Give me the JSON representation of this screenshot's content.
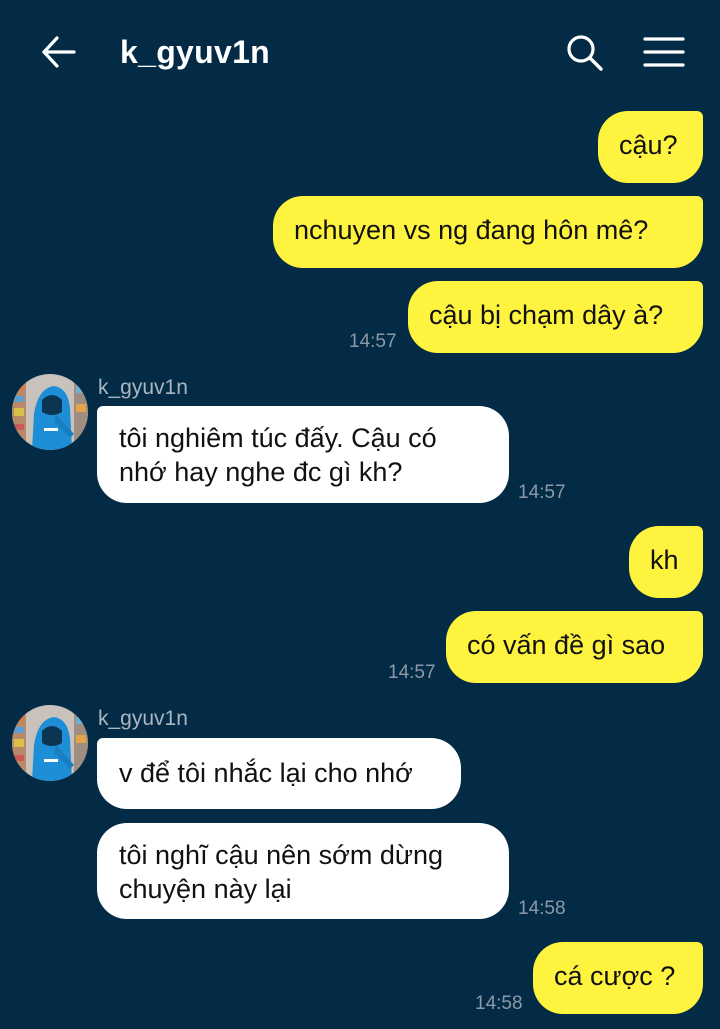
{
  "header": {
    "title": "k_gyuv1n",
    "back_icon": "arrow-left-icon",
    "search_icon": "search-icon",
    "menu_icon": "menu-icon"
  },
  "colors": {
    "background": "#032b45",
    "my_bubble": "#fef33f",
    "their_bubble": "#ffffff",
    "timestamp": "#8b9aa6"
  },
  "messages": {
    "m1": "cậu?",
    "m2": "nchuyen vs ng đang hôn mê?",
    "m3": "cậu bị chạm dây à?",
    "m3_time": "14:57",
    "g1_sender": "k_gyuv1n",
    "m4_line1": "tôi nghiêm túc đấy. Cậu có",
    "m4_line2": "nhớ hay nghe đc gì kh?",
    "m4_time": "14:57",
    "m5": "kh",
    "m6": "có vấn đề gì sao",
    "m6_time": "14:57",
    "g2_sender": "k_gyuv1n",
    "m7": "v để tôi nhắc lại cho nhớ",
    "m8_line1": "tôi nghĩ cậu nên sớm dừng",
    "m8_line2": "chuyện này lại",
    "m8_time": "14:58",
    "m9": "cá cược ?",
    "m9_time": "14:58"
  }
}
